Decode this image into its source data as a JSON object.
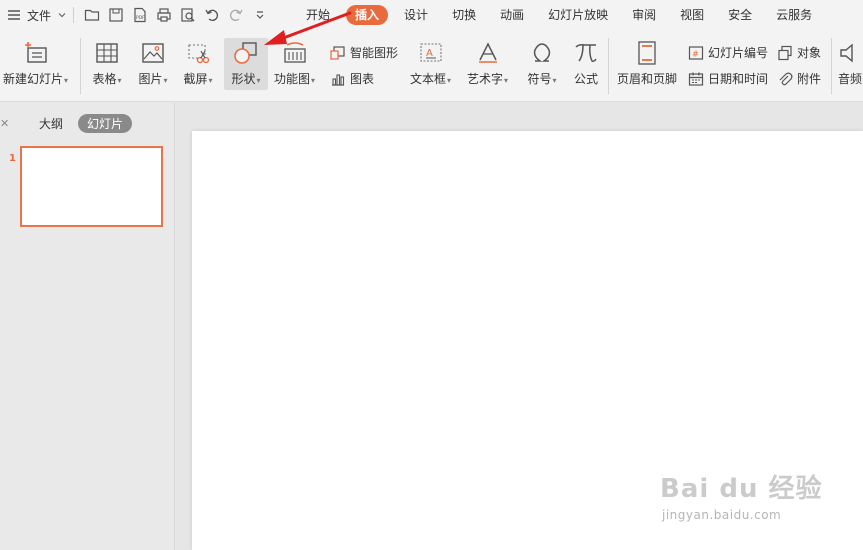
{
  "menubar": {
    "file_label": "文件",
    "tabs": [
      {
        "label": "开始",
        "active": false
      },
      {
        "label": "插入",
        "active": true
      },
      {
        "label": "设计",
        "active": false
      },
      {
        "label": "切换",
        "active": false
      },
      {
        "label": "动画",
        "active": false
      },
      {
        "label": "幻灯片放映",
        "active": false
      },
      {
        "label": "审阅",
        "active": false
      },
      {
        "label": "视图",
        "active": false
      },
      {
        "label": "安全",
        "active": false
      },
      {
        "label": "云服务",
        "active": false
      }
    ],
    "quick_access_icons": [
      "open-folder-icon",
      "save-icon",
      "export-pdf-icon",
      "print-icon",
      "print-preview-icon",
      "undo-icon",
      "redo-icon",
      "customize-dropdown-icon"
    ]
  },
  "ribbon": {
    "new_slide": "新建幻灯片",
    "table": "表格",
    "picture": "图片",
    "screenshot": "截屏",
    "shape": "形状",
    "function_chart": "功能图",
    "smart_art": "智能图形",
    "chart": "图表",
    "text_box": "文本框",
    "word_art": "艺术字",
    "symbol": "符号",
    "formula": "公式",
    "header_footer": "页眉和页脚",
    "slide_number": "幻灯片编号",
    "date_time": "日期和时间",
    "object": "对象",
    "attachment": "附件",
    "audio": "音频"
  },
  "leftpane": {
    "outline_tab": "大纲",
    "slides_tab": "幻灯片",
    "slide_number": "1"
  },
  "watermark": {
    "brand": "Bai du 经验",
    "site": "jingyan.baidu.com"
  },
  "colors": {
    "accent": "#e96a3d",
    "annotation_arrow": "#e02020",
    "ribbon_bg": "#f3f3f3"
  }
}
